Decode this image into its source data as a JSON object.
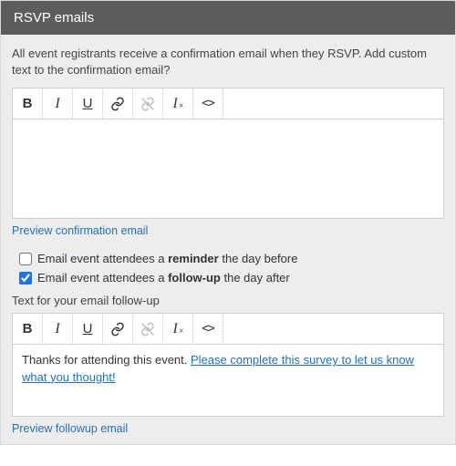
{
  "header": {
    "title": "RSVP emails"
  },
  "intro": "All event registrants receive a confirmation email when they RSVP. Add custom text to the confirmation email?",
  "editor1": {
    "content": ""
  },
  "preview1": "Preview confirmation email",
  "reminder": {
    "checked": false,
    "prefix": "Email event attendees a ",
    "bold": "reminder",
    "suffix": " the day before"
  },
  "followup": {
    "checked": true,
    "prefix": "Email event attendees a ",
    "bold": "follow-up",
    "suffix": " the day after"
  },
  "followup_label": "Text for your email follow-up",
  "editor2": {
    "text": "Thanks for attending this event. ",
    "link": "Please complete this survey to let us know what you thought!"
  },
  "preview2": "Preview followup email"
}
